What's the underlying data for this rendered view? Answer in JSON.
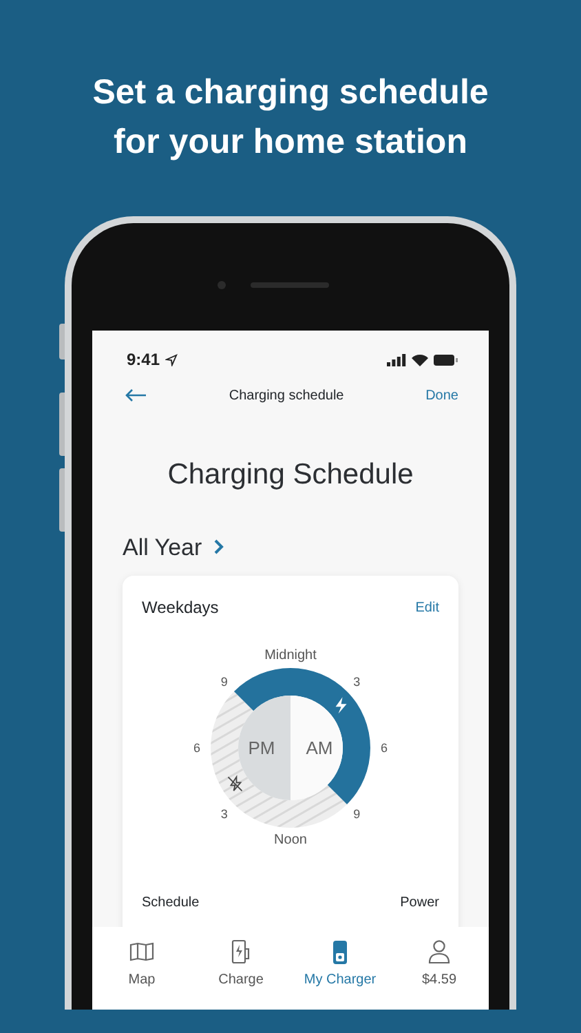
{
  "headline": [
    "Set a charging schedule",
    "for your home station"
  ],
  "status_bar": {
    "time": "9:41"
  },
  "nav": {
    "title": "Charging schedule",
    "action": "Done"
  },
  "heading": "Charging Schedule",
  "period": "All Year",
  "card": {
    "title": "Weekdays",
    "action": "Edit",
    "clock": {
      "top": "Midnight",
      "bottom": "Noon",
      "left_center": "PM",
      "right_center": "AM",
      "hours": [
        "3",
        "6",
        "9",
        "3",
        "6",
        "9"
      ]
    },
    "columns": [
      "Schedule",
      "Power"
    ]
  },
  "tabs": [
    {
      "label": "Map",
      "kind": "map",
      "selected": false
    },
    {
      "label": "Charge",
      "kind": "charge",
      "selected": false
    },
    {
      "label": "My Charger",
      "kind": "charger",
      "selected": true
    },
    {
      "label": "$4.59",
      "kind": "account",
      "selected": false
    }
  ]
}
